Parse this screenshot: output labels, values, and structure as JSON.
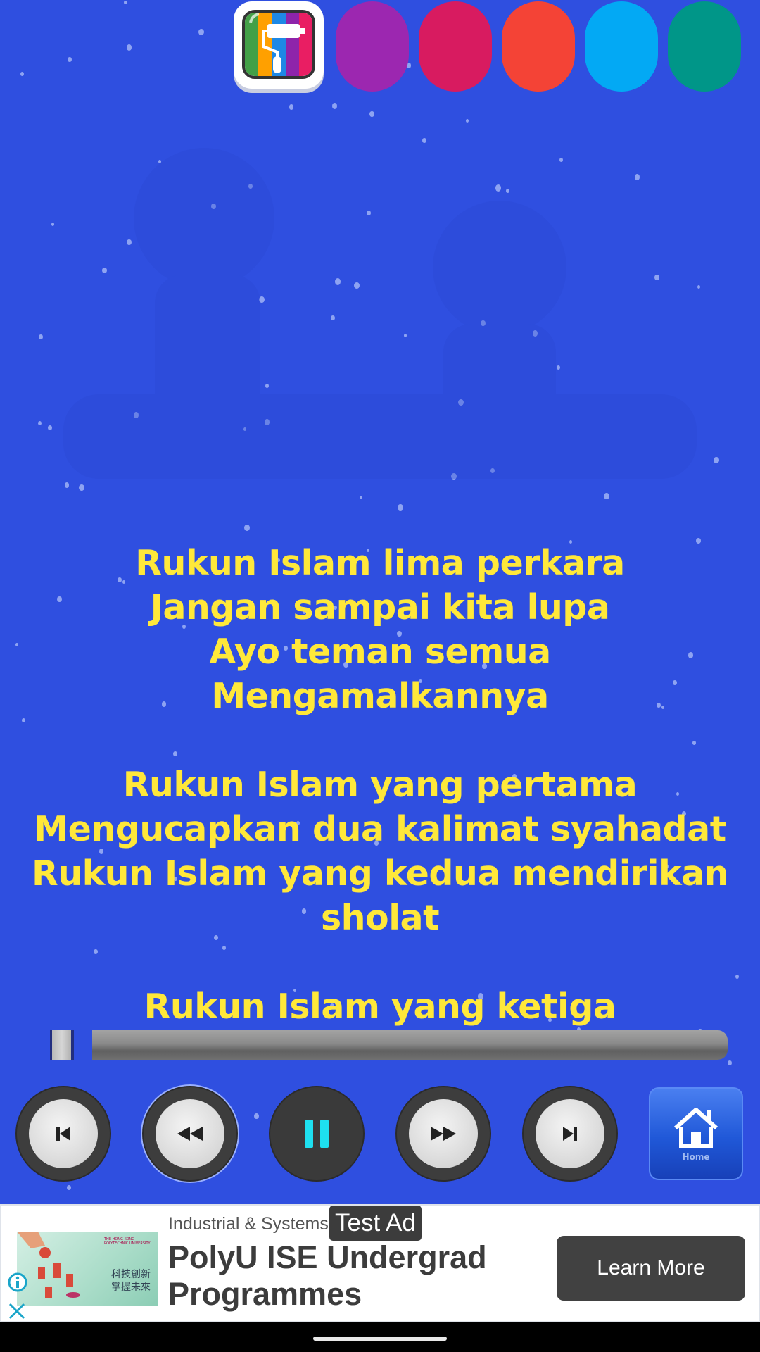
{
  "theme_picker": {
    "active_icon": "paint-roller-icon",
    "active_stripes": [
      "#43a047",
      "#ffa000",
      "#1e88e5",
      "#8e24aa",
      "#e91e63"
    ],
    "swatches": [
      {
        "name": "purple",
        "color": "#9c27b0"
      },
      {
        "name": "crimson",
        "color": "#d81b60"
      },
      {
        "name": "red-orange",
        "color": "#f44336"
      },
      {
        "name": "sky-blue",
        "color": "#03a9f4"
      },
      {
        "name": "teal",
        "color": "#009688"
      }
    ]
  },
  "colors": {
    "background": "#2f4fe0",
    "lyrics_text": "#ffe83a",
    "pause_accent": "#1ee0f0"
  },
  "lyrics": {
    "stanzas": [
      [
        "Rukun Islam lima perkara",
        "Jangan sampai kita lupa",
        "Ayo teman semua",
        "Mengamalkannya"
      ],
      [
        "Rukun Islam yang pertama",
        "Mengucapkan dua kalimat syahadat",
        "Rukun Islam yang kedua mendirikan",
        "sholat"
      ],
      [
        "Rukun Islam yang ketiga"
      ]
    ]
  },
  "player": {
    "progress_percent": 1,
    "state": "playing",
    "controls": {
      "previous": "skip-previous-icon",
      "rewind": "rewind-icon",
      "pause": "pause-icon",
      "fast_forward": "fast-forward-icon",
      "next": "skip-next-icon",
      "home": "home-icon"
    },
    "home_label": "Home"
  },
  "ad": {
    "category": "Industrial & Systems",
    "badge": "Test Ad",
    "title": "PolyU ISE Undergrad Programmes",
    "cta": "Learn More",
    "image_text_cn": "科技創新\n掌握未來",
    "image_text_uni": "THE HONG KONG POLYTECHNIC UNIVERSITY",
    "info_icon": "info-icon",
    "close_icon": "close-icon"
  }
}
